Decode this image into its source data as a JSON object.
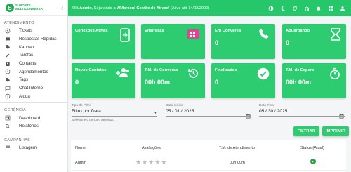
{
  "sidebar": {
    "logo_text": [
      "SUPORTE",
      "MULTICONVERSA"
    ],
    "sections": {
      "atendimento": "ATENDIMENTO",
      "gerencia": "GERÊNCIA",
      "campanhas": "CAMPANHAS"
    },
    "items": [
      {
        "label": "Tickets",
        "icon": "whatsapp-icon"
      },
      {
        "label": "Respostas Rápidas",
        "icon": "quick-reply-icon"
      },
      {
        "label": "Kanban",
        "icon": "kanban-icon"
      },
      {
        "label": "Tarefas",
        "icon": "tasks-icon"
      },
      {
        "label": "Contacts",
        "icon": "contacts-icon"
      },
      {
        "label": "Agendamentos",
        "icon": "schedule-icon"
      },
      {
        "label": "Tags",
        "icon": "tag-icon"
      },
      {
        "label": "Chat Interno",
        "icon": "chat-icon"
      },
      {
        "label": "Ajuda",
        "icon": "help-icon"
      }
    ],
    "gerencia_items": [
      {
        "label": "Dashboard",
        "icon": "dashboard-icon"
      },
      {
        "label": "Relatórios",
        "icon": "search-icon"
      }
    ],
    "campanhas_items": [
      {
        "label": "Listagem",
        "icon": "list-icon"
      }
    ]
  },
  "topbar": {
    "welcome_prefix": "Olá ",
    "user": "Admin",
    "welcome_mid": ", Seja vindo a ",
    "company": "WMarconi Gestão de Ativos",
    "welcome_suffix": "! (Ativo até 14/03/2090)",
    "icons": [
      "contrast-icon",
      "moon-icon",
      "refresh-icon",
      "headset-icon",
      "bell-icon",
      "grid-icon",
      "user-icon"
    ]
  },
  "cards": [
    {
      "label": "Conexões Ativas",
      "value": "",
      "icon": "phone-device-icon"
    },
    {
      "label": "Empresas",
      "value": "",
      "icon": "company-icon"
    },
    {
      "label": "Em Conversa",
      "value": "0",
      "icon": "phone-call-icon"
    },
    {
      "label": "Aguardando",
      "value": "0",
      "icon": "hourglass-icon"
    },
    {
      "label": "Novos Contatos",
      "value": "0",
      "icon": "add-group-icon"
    },
    {
      "label": "T.M. de Conversa",
      "value": "00h 00m",
      "icon": "clock-history-icon"
    },
    {
      "label": "Finalizados",
      "value": "0",
      "icon": "check-circle-icon"
    },
    {
      "label": "T.M. de Espera",
      "value": "00h 00m",
      "icon": "timer-icon"
    }
  ],
  "filters": {
    "type_label": "Tipo de Filtro",
    "type_value": "Filtro por Data",
    "type_helper": "Selecione o período desejado",
    "start_label": "Data Inicial",
    "start_value": "05 / 01 / 2025",
    "end_label": "Data Final",
    "end_value": "05 / 30 / 2025"
  },
  "buttons": {
    "filter": "FILTRAR",
    "print": "IMPRIMIR"
  },
  "table": {
    "headers": [
      "Nome",
      "Avaliações",
      "T.M. de Atendimento",
      "Status (Atual)"
    ],
    "rows": [
      {
        "name": "Admin",
        "rating": 0,
        "tm": "00h 00m",
        "status": "online"
      }
    ]
  },
  "colors": {
    "brand": "#2ecc71",
    "topbar": "#26c76b",
    "status_online": "#2ea043",
    "company_icon": "#e84393"
  }
}
